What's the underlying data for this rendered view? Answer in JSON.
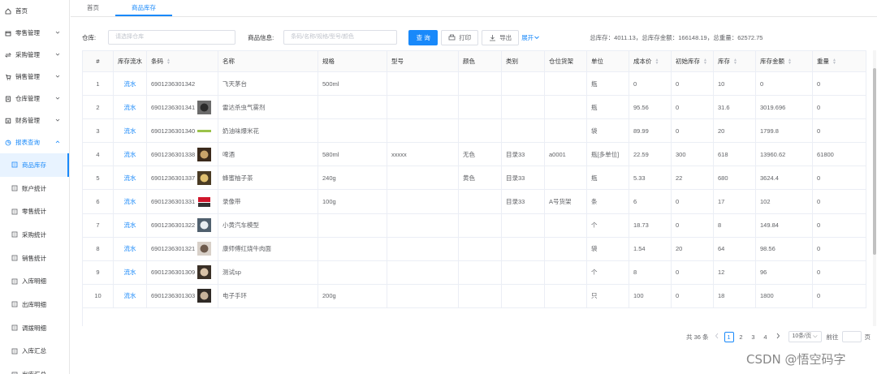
{
  "sidebar": {
    "home": "首页",
    "menus": [
      {
        "label": "零售管理",
        "icon": "shop-icon"
      },
      {
        "label": "采购管理",
        "icon": "swap-icon"
      },
      {
        "label": "销售管理",
        "icon": "cart-icon"
      },
      {
        "label": "仓库管理",
        "icon": "document-icon"
      },
      {
        "label": "财务管理",
        "icon": "finance-icon"
      }
    ],
    "open_menu": "报表查询",
    "submenu": [
      "商品库存",
      "账户统计",
      "零售统计",
      "采购统计",
      "销售统计",
      "入库明细",
      "出库明细",
      "调拨明细",
      "入库汇总",
      "出库汇总"
    ]
  },
  "tabs": [
    "首页",
    "商品库存"
  ],
  "filters": {
    "warehouse_label": "仓库:",
    "warehouse_placeholder": "请选择仓库",
    "product_label": "商品信息:",
    "product_placeholder": "条码/名称/规格/型号/颜色",
    "query_btn": "查 询",
    "print_btn": "打印",
    "export_btn": "导出",
    "expand_btn": "展开",
    "summary": "总库存：4011.13，总库存金额：166148.19，总重量：62572.75"
  },
  "table": {
    "headers": [
      "#",
      "库存流水",
      "条码",
      "名称",
      "规格",
      "型号",
      "颜色",
      "类别",
      "仓位货架",
      "单位",
      "成本价",
      "初始库存",
      "库存",
      "库存金额",
      "重量"
    ],
    "sortable": [
      false,
      false,
      true,
      false,
      false,
      false,
      false,
      false,
      false,
      false,
      true,
      true,
      true,
      true,
      true
    ],
    "rows": [
      {
        "no": "1",
        "flow": "流水",
        "barcode": "6901236301342",
        "thumb": "",
        "name": "飞天茅台",
        "spec": "500ml",
        "model": "",
        "color": "",
        "category": "",
        "shelf": "",
        "unit": "瓶",
        "cost": "0",
        "init_stock": "0",
        "stock": "10",
        "amount": "0",
        "weight": "0"
      },
      {
        "no": "2",
        "flow": "流水",
        "barcode": "6901236301341",
        "thumb": "spray",
        "name": "雷达杀虫气雾剂",
        "spec": "",
        "model": "",
        "color": "",
        "category": "",
        "shelf": "",
        "unit": "瓶",
        "cost": "95.56",
        "init_stock": "0",
        "stock": "31.6",
        "amount": "3019.696",
        "weight": "0"
      },
      {
        "no": "3",
        "flow": "流水",
        "barcode": "6901236301340",
        "thumb": "snack",
        "name": "奶油味爆米花",
        "spec": "",
        "model": "",
        "color": "",
        "category": "",
        "shelf": "",
        "unit": "袋",
        "cost": "89.99",
        "init_stock": "0",
        "stock": "20",
        "amount": "1799.8",
        "weight": "0"
      },
      {
        "no": "4",
        "flow": "流水",
        "barcode": "6901236301338",
        "thumb": "beer",
        "name": "啤酒",
        "spec": "580ml",
        "model": "xxxxx",
        "color": "无色",
        "category": "目录33",
        "shelf": "a0001",
        "unit": "瓶[多单位]",
        "cost": "22.59",
        "init_stock": "300",
        "stock": "618",
        "amount": "13960.62",
        "weight": "61800"
      },
      {
        "no": "5",
        "flow": "流水",
        "barcode": "6901236301337",
        "thumb": "tea",
        "name": "蜂蜜柚子茶",
        "spec": "240g",
        "model": "",
        "color": "黄色",
        "category": "目录33",
        "shelf": "",
        "unit": "瓶",
        "cost": "5.33",
        "init_stock": "22",
        "stock": "680",
        "amount": "3624.4",
        "weight": "0"
      },
      {
        "no": "6",
        "flow": "流水",
        "barcode": "6901236301331",
        "thumb": "tape",
        "name": "录像带",
        "spec": "100g",
        "model": "",
        "color": "",
        "category": "目录33",
        "shelf": "A号货架",
        "unit": "条",
        "cost": "6",
        "init_stock": "0",
        "stock": "17",
        "amount": "102",
        "weight": "0"
      },
      {
        "no": "7",
        "flow": "流水",
        "barcode": "6901236301322",
        "thumb": "car",
        "name": "小黄汽车模型",
        "spec": "",
        "model": "",
        "color": "",
        "category": "",
        "shelf": "",
        "unit": "个",
        "cost": "18.73",
        "init_stock": "0",
        "stock": "8",
        "amount": "149.84",
        "weight": "0"
      },
      {
        "no": "8",
        "flow": "流水",
        "barcode": "6901236301321",
        "thumb": "noodle",
        "name": "康师傅红烧牛肉面",
        "spec": "",
        "model": "",
        "color": "",
        "category": "",
        "shelf": "",
        "unit": "袋",
        "cost": "1.54",
        "init_stock": "20",
        "stock": "64",
        "amount": "98.56",
        "weight": "0"
      },
      {
        "no": "9",
        "flow": "流水",
        "barcode": "6901236301309",
        "thumb": "person",
        "name": "测试sp",
        "spec": "",
        "model": "",
        "color": "",
        "category": "",
        "shelf": "",
        "unit": "个",
        "cost": "8",
        "init_stock": "0",
        "stock": "12",
        "amount": "96",
        "weight": "0"
      },
      {
        "no": "10",
        "flow": "流水",
        "barcode": "6901236301303",
        "thumb": "person2",
        "name": "电子手环",
        "spec": "200g",
        "model": "",
        "color": "",
        "category": "",
        "shelf": "",
        "unit": "只",
        "cost": "100",
        "init_stock": "0",
        "stock": "18",
        "amount": "1800",
        "weight": "0"
      }
    ]
  },
  "pagination": {
    "total": "共 36 条",
    "pages": [
      "1",
      "2",
      "3",
      "4"
    ],
    "current": "1",
    "page_size": "10条/页",
    "goto_label": "前往",
    "page_unit": "页"
  },
  "watermark": "CSDN @悟空码字",
  "colors": {
    "accent": "#1989fa",
    "border": "#ebeef5",
    "text": "#606266"
  }
}
